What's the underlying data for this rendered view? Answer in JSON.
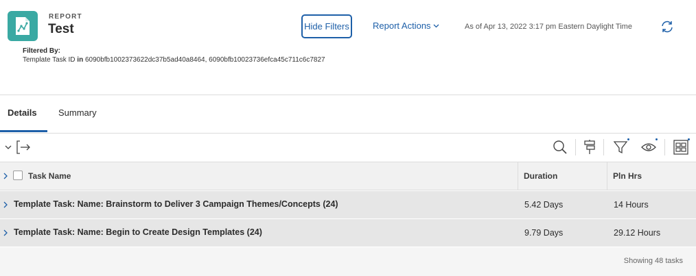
{
  "header": {
    "kicker": "REPORT",
    "title": "Test",
    "hide_filters_label": "Hide Filters",
    "report_actions_label": "Report Actions",
    "as_of": "As of Apr 13, 2022 3:17 pm Eastern Daylight Time",
    "filtered_by_label": "Filtered By:",
    "filter_field": "Template Task ID",
    "filter_operator": "in",
    "filter_values": "6090bfb1002373622dc37b5ad40a8464, 6090bfb10023736efca45c711c6c7827",
    "icon_color": "#3aa9a3"
  },
  "tabs": [
    {
      "label": "Details",
      "active": true
    },
    {
      "label": "Summary",
      "active": false
    }
  ],
  "toolbar": {
    "icons": [
      "collapse-chevron-icon",
      "export-icon",
      "search-icon",
      "grouping-icon",
      "filter-icon",
      "view-eye-icon",
      "grid-layout-icon"
    ]
  },
  "table": {
    "columns": [
      "Task Name",
      "Duration",
      "Pln Hrs"
    ],
    "rows": [
      {
        "name": "Template Task: Name: Brainstorm to Deliver 3 Campaign Themes/Concepts (24)",
        "duration": "5.42 Days",
        "planned_hours": "14 Hours"
      },
      {
        "name": "Template Task: Name: Begin to Create Design Templates (24)",
        "duration": "9.79 Days",
        "planned_hours": "29.12 Hours"
      }
    ]
  },
  "footer": {
    "showing": "Showing 48 tasks"
  },
  "colors": {
    "accent": "#1d5fa8",
    "row_bg": "#e6e6e6",
    "header_bg": "#f1f1f1"
  }
}
